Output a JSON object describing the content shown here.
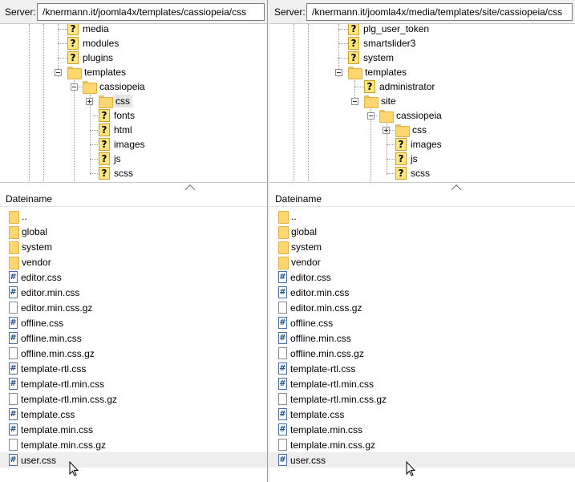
{
  "left": {
    "server_label": "Server:",
    "server_path": "/knermann.it/joomla4x/templates/cassiopeia/css",
    "tree": [
      {
        "label": "media",
        "icon": "unknown"
      },
      {
        "label": "modules",
        "icon": "unknown"
      },
      {
        "label": "plugins",
        "icon": "unknown"
      },
      {
        "label": "templates",
        "icon": "folder"
      },
      {
        "label": "cassiopeia",
        "icon": "folder"
      },
      {
        "label": "css",
        "icon": "folder"
      },
      {
        "label": "fonts",
        "icon": "unknown"
      },
      {
        "label": "html",
        "icon": "unknown"
      },
      {
        "label": "images",
        "icon": "unknown"
      },
      {
        "label": "js",
        "icon": "unknown"
      },
      {
        "label": "scss",
        "icon": "unknown"
      }
    ],
    "list_header": "Dateiname",
    "files": [
      {
        "name": "..",
        "type": "folder"
      },
      {
        "name": "global",
        "type": "folder"
      },
      {
        "name": "system",
        "type": "folder"
      },
      {
        "name": "vendor",
        "type": "folder"
      },
      {
        "name": "editor.css",
        "type": "css"
      },
      {
        "name": "editor.min.css",
        "type": "css"
      },
      {
        "name": "editor.min.css.gz",
        "type": "file"
      },
      {
        "name": "offline.css",
        "type": "css"
      },
      {
        "name": "offline.min.css",
        "type": "css"
      },
      {
        "name": "offline.min.css.gz",
        "type": "file"
      },
      {
        "name": "template-rtl.css",
        "type": "css"
      },
      {
        "name": "template-rtl.min.css",
        "type": "css"
      },
      {
        "name": "template-rtl.min.css.gz",
        "type": "file"
      },
      {
        "name": "template.css",
        "type": "css"
      },
      {
        "name": "template.min.css",
        "type": "css"
      },
      {
        "name": "template.min.css.gz",
        "type": "file"
      },
      {
        "name": "user.css",
        "type": "css"
      }
    ]
  },
  "right": {
    "server_label": "Server:",
    "server_path": "/knermann.it/joomla4x/media/templates/site/cassiopeia/css",
    "tree": [
      {
        "label": "plg_user_token",
        "icon": "unknown"
      },
      {
        "label": "smartslider3",
        "icon": "unknown"
      },
      {
        "label": "system",
        "icon": "unknown"
      },
      {
        "label": "templates",
        "icon": "folder"
      },
      {
        "label": "administrator",
        "icon": "unknown"
      },
      {
        "label": "site",
        "icon": "folder"
      },
      {
        "label": "cassiopeia",
        "icon": "folder"
      },
      {
        "label": "css",
        "icon": "folder"
      },
      {
        "label": "images",
        "icon": "unknown"
      },
      {
        "label": "js",
        "icon": "unknown"
      },
      {
        "label": "scss",
        "icon": "unknown"
      }
    ],
    "list_header": "Dateiname",
    "files": [
      {
        "name": "..",
        "type": "folder"
      },
      {
        "name": "global",
        "type": "folder"
      },
      {
        "name": "system",
        "type": "folder"
      },
      {
        "name": "vendor",
        "type": "folder"
      },
      {
        "name": "editor.css",
        "type": "css"
      },
      {
        "name": "editor.min.css",
        "type": "css"
      },
      {
        "name": "editor.min.css.gz",
        "type": "file"
      },
      {
        "name": "offline.css",
        "type": "css"
      },
      {
        "name": "offline.min.css",
        "type": "css"
      },
      {
        "name": "offline.min.css.gz",
        "type": "file"
      },
      {
        "name": "template-rtl.css",
        "type": "css"
      },
      {
        "name": "template-rtl.min.css",
        "type": "css"
      },
      {
        "name": "template-rtl.min.css.gz",
        "type": "file"
      },
      {
        "name": "template.css",
        "type": "css"
      },
      {
        "name": "template.min.css",
        "type": "css"
      },
      {
        "name": "template.min.css.gz",
        "type": "file"
      },
      {
        "name": "user.css",
        "type": "css"
      }
    ]
  },
  "glyphs": {
    "unknown_icon": "?",
    "css_icon": "#"
  }
}
